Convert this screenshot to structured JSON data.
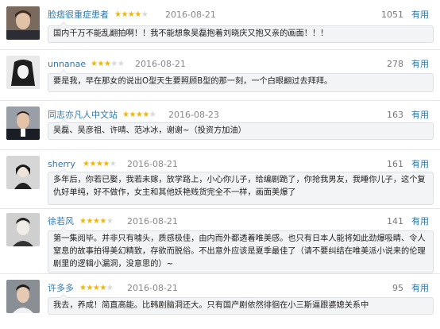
{
  "reviews": [
    {
      "user": "脸痞很重症患者",
      "rating": 4,
      "stars": "★★★★",
      "stars_off": "★",
      "date": "2016-08-21",
      "votes": "1051",
      "useful": "有用",
      "text": "国内千万不能乱翻拍啊！！我不能想象吴磊抱着刘晓庆又抱又亲的画面！！！"
    },
    {
      "user": "unnanae",
      "rating": 3,
      "stars": "★★★",
      "stars_off": "★★",
      "date": "2016-08-21",
      "votes": "278",
      "useful": "有用",
      "text": "要是我，早在那女的说出O型天生要照顾B型的那一刻，一个白眼翻过去拜拜。"
    },
    {
      "user": "同志亦凡人中文站",
      "rating": 4,
      "stars": "★★★★",
      "stars_off": "★",
      "date": "2016-08-23",
      "votes": "163",
      "useful": "有用",
      "text": "吴磊、吴彦祖、许晴、范冰冰，谢谢~（投资方加油）"
    },
    {
      "user": "sherry",
      "rating": 4,
      "stars": "★★★★",
      "stars_off": "★",
      "date": "2016-08-21",
      "votes": "161",
      "useful": "有用",
      "text": "多年后，你若已娶，我若未嫁，放学路上，小心你儿子，给编剧跪了，你抢我男友，我睡你儿子，这个复仇好单纯，好不做作，女主和其他妖艳贱货完全不一样，画面美爆了"
    },
    {
      "user": "徐若风",
      "rating": 4,
      "stars": "★★★★",
      "stars_off": "★",
      "date": "2016-08-21",
      "votes": "141",
      "useful": "有用",
      "text": "第一集阅毕。并非只有噱头，质感极佳，由内而外都透着唯美感。也只有日本人能将如此劲爆吸睛、令人窒息的故事拍得美幻精致，存欲而脱俗。不出意外应该是夏季最佳了（请不要纠结在唯美派小说来的伦理剧里的逻辑小漏洞，没意思的）~"
    },
    {
      "user": "许多多",
      "rating": 4,
      "stars": "★★★★",
      "stars_off": "★",
      "date": "2016-08-21",
      "votes": "95",
      "useful": "有用",
      "text": "我去，养成！简直高能。比韩剧脑洞还大。只有国产剧依然徘徊在小三斯逼跟婆媳关系中"
    }
  ]
}
